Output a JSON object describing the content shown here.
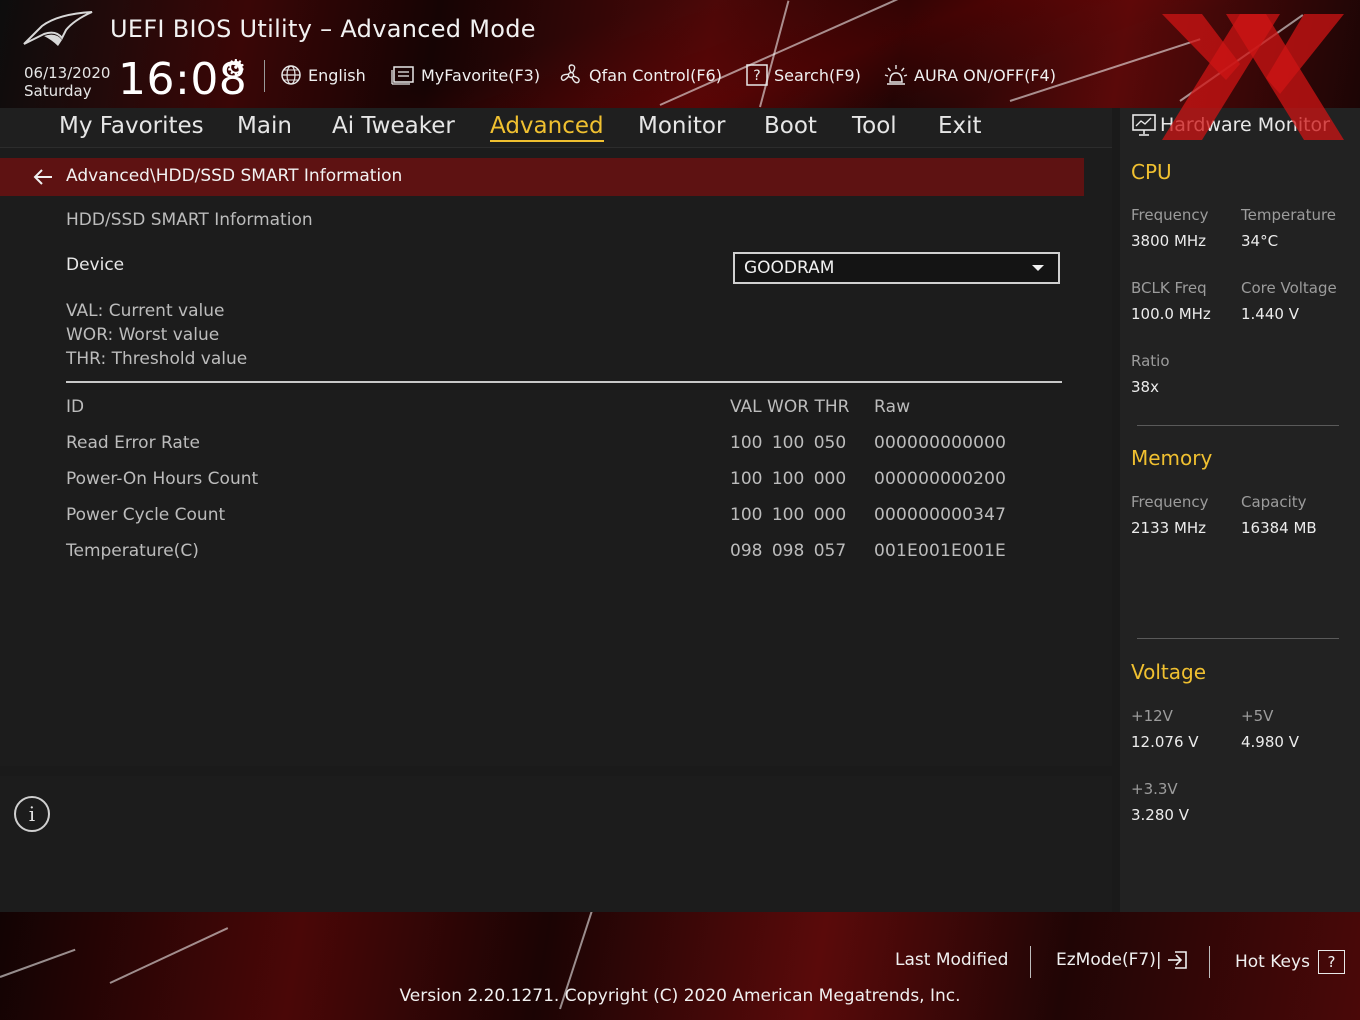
{
  "header": {
    "title": "UEFI BIOS Utility – Advanced Mode",
    "date": "06/13/2020",
    "day": "Saturday",
    "time": "16:08",
    "language": "English",
    "my_favorite": "MyFavorite(F3)",
    "qfan": "Qfan Control(F6)",
    "search": "Search(F9)",
    "aura": "AURA ON/OFF(F4)"
  },
  "nav": {
    "tabs": [
      {
        "label": "My Favorites",
        "active": false
      },
      {
        "label": "Main",
        "active": false
      },
      {
        "label": "Ai Tweaker",
        "active": false
      },
      {
        "label": "Advanced",
        "active": true
      },
      {
        "label": "Monitor",
        "active": false
      },
      {
        "label": "Boot",
        "active": false
      },
      {
        "label": "Tool",
        "active": false
      },
      {
        "label": "Exit",
        "active": false
      }
    ]
  },
  "content": {
    "breadcrumb": "Advanced\\HDD/SSD SMART Information",
    "section_title": "HDD/SSD SMART Information",
    "device_label": "Device",
    "device_value": "GOODRAM",
    "legend": {
      "val": "VAL:  Current value",
      "wor": "WOR: Worst value",
      "thr": "THR:  Threshold value"
    },
    "table": {
      "headers": {
        "id": "ID",
        "vals": "VAL WOR THR",
        "raw": "Raw"
      },
      "rows": [
        {
          "name": "Read Error Rate",
          "vals": "100  100  050",
          "raw": "000000000000"
        },
        {
          "name": "Power-On Hours Count",
          "vals": "100  100  000",
          "raw": "000000000200"
        },
        {
          "name": "Power Cycle Count",
          "vals": "100  100  000",
          "raw": "000000000347"
        },
        {
          "name": "Temperature(C)",
          "vals": "098  098  057",
          "raw": "001E001E001E"
        }
      ]
    }
  },
  "hardware_monitor": {
    "title": "Hardware Monitor",
    "cpu": {
      "title": "CPU",
      "frequency_label": "Frequency",
      "frequency_value": "3800 MHz",
      "temperature_label": "Temperature",
      "temperature_value": "34°C",
      "bclk_label": "BCLK Freq",
      "bclk_value": "100.0 MHz",
      "core_voltage_label": "Core Voltage",
      "core_voltage_value": "1.440 V",
      "ratio_label": "Ratio",
      "ratio_value": "38x"
    },
    "memory": {
      "title": "Memory",
      "frequency_label": "Frequency",
      "frequency_value": "2133 MHz",
      "capacity_label": "Capacity",
      "capacity_value": "16384 MB"
    },
    "voltage": {
      "title": "Voltage",
      "v12_label": "+12V",
      "v12_value": "12.076 V",
      "v5_label": "+5V",
      "v5_value": "4.980 V",
      "v33_label": "+3.3V",
      "v33_value": "3.280 V"
    }
  },
  "footer": {
    "last_modified": "Last Modified",
    "ezmode": "EzMode(F7)|",
    "hot_keys": "Hot Keys",
    "version": "Version 2.20.1271. Copyright (C) 2020 American Megatrends, Inc."
  },
  "colors": {
    "accent": "#f0c030",
    "breadcrumb_bg": "#5e1212",
    "panel_bg": "#1c1c1c"
  }
}
